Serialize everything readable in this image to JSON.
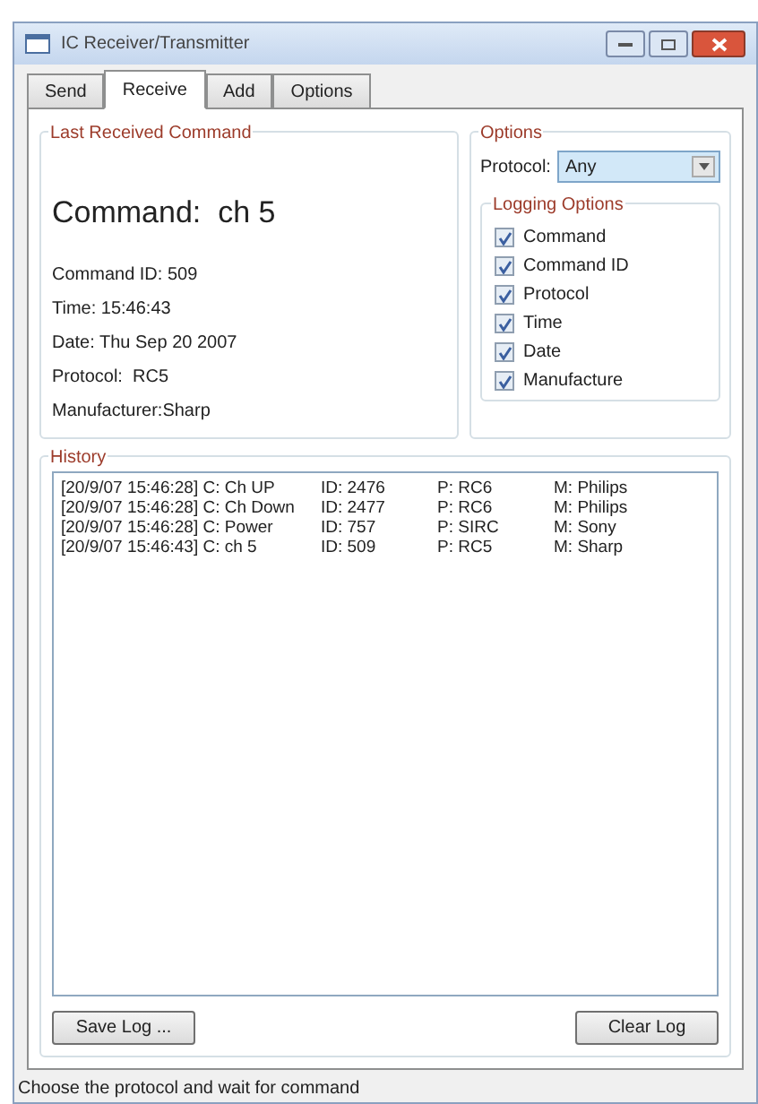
{
  "window": {
    "title": "IC Receiver/Transmitter"
  },
  "tabs": [
    {
      "label": "Send",
      "selected": false
    },
    {
      "label": "Receive",
      "selected": true
    },
    {
      "label": "Add",
      "selected": false
    },
    {
      "label": "Options",
      "selected": false
    }
  ],
  "last_received": {
    "title": "Last Received Command",
    "command": "Command:  ch 5",
    "details": [
      "Command ID: 509",
      "Time: 15:46:43",
      "Date: Thu Sep 20 2007",
      "Protocol:  RC5",
      "Manufacturer:Sharp"
    ]
  },
  "options": {
    "title": "Options",
    "protocol_label": "Protocol:",
    "protocol_value": "Any",
    "logging_title": "Logging Options",
    "logging": [
      {
        "label": "Command",
        "checked": true
      },
      {
        "label": "Command ID",
        "checked": true
      },
      {
        "label": "Protocol",
        "checked": true
      },
      {
        "label": "Time",
        "checked": true
      },
      {
        "label": "Date",
        "checked": true
      },
      {
        "label": "Manufacture",
        "checked": true
      }
    ]
  },
  "history": {
    "title": "History",
    "rows": [
      {
        "entry": "[20/9/07 15:46:28] C: Ch UP",
        "id": "ID: 2476",
        "protocol": "P: RC6",
        "manufacturer": "M: Philips"
      },
      {
        "entry": "[20/9/07 15:46:28] C: Ch Down",
        "id": "ID: 2477",
        "protocol": "P: RC6",
        "manufacturer": "M: Philips"
      },
      {
        "entry": "[20/9/07 15:46:28] C: Power",
        "id": "ID: 757",
        "protocol": "P: SIRC",
        "manufacturer": "M: Sony"
      },
      {
        "entry": "[20/9/07 15:46:43] C: ch 5",
        "id": "ID: 509",
        "protocol": "P: RC5",
        "manufacturer": "M: Sharp"
      }
    ]
  },
  "buttons": [
    "Save Log ...",
    "Clear Log"
  ],
  "status_bar": "Choose the protocol and wait for command"
}
